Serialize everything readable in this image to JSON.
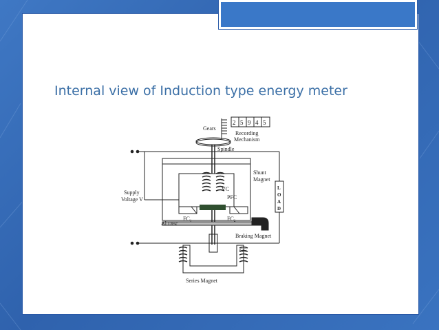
{
  "slide": {
    "title": "Internal view of Induction type energy meter"
  },
  "diagram": {
    "labels": {
      "gears": "Gears",
      "register_digits": [
        "2",
        "5",
        "9",
        "4",
        "5"
      ],
      "recording": "Recording",
      "mechanism": "Mechanism",
      "spindle": "Spindle",
      "shunt": "Shunt",
      "magnet": "Magnet",
      "vc": "VC",
      "pfc": "PFC",
      "supply": "Supply",
      "voltage": "Voltage V",
      "fc1": "FC₁",
      "fc2": "FC₂",
      "al_disc": "Al Disc",
      "braking_magnet": "Braking Magnet",
      "cc": "CC",
      "series_magnet": "Series Magnet",
      "load_letters": [
        "L",
        "O",
        "A",
        "D"
      ]
    }
  },
  "colors": {
    "background": "#3466b5",
    "slide": "#ffffff",
    "tab": "#3a78c8",
    "title": "#3b6fa6"
  }
}
